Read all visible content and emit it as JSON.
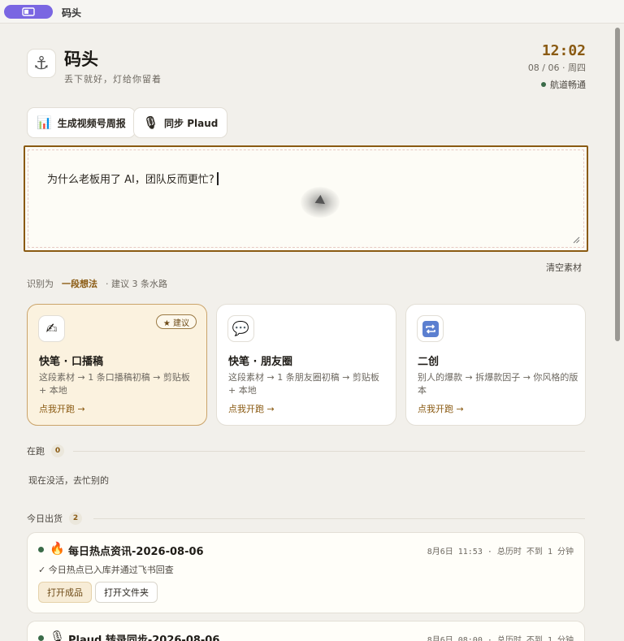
{
  "window": {
    "title": "码头"
  },
  "header": {
    "logo_icon": "anchor-icon",
    "title": "码头",
    "subtitle": "丢下就好，灯给你留着",
    "clock": "12:02",
    "date": "08 / 06 · 周四",
    "status": "航道畅通",
    "status_color": "#3a6b48"
  },
  "actions": [
    {
      "icon": "bar-chart-icon",
      "label": "生成视频号周报"
    },
    {
      "icon": "microphone-icon",
      "label": "同步 Plaud"
    }
  ],
  "editor": {
    "value": "为什么老板用了 AI，团队反而更忙?"
  },
  "clear_label": "清空素材",
  "detection": {
    "prefix": "识别为",
    "type": "一段想法",
    "suggestion": "· 建议 3 条水路"
  },
  "cards": [
    {
      "icon": "writing-hand-icon",
      "title": "快笔 · 口播稿",
      "desc": "这段素材 → 1 条口播稿初稿 → 剪贴板 + 本地",
      "link": "点我开跑 →",
      "badge": "★ 建议"
    },
    {
      "icon": "speech-bubble-icon",
      "title": "快笔 · 朋友圈",
      "desc": "这段素材 → 1 条朋友圈初稿 → 剪贴板 + 本地",
      "link": "点我开跑 →"
    },
    {
      "icon": "repeat-icon",
      "title": "二创",
      "desc": "别人的爆款 → 拆爆款因子 → 你风格的版本",
      "link": "点我开跑 →"
    }
  ],
  "running": {
    "label": "在跑",
    "count": "0",
    "empty": "现在没活，去忙别的"
  },
  "shipped": {
    "label": "今日出货",
    "count": "2",
    "tasks": [
      {
        "icon": "fire-icon",
        "title": "每日热点资讯-2026-08-06",
        "meta": "8月6日 11:53 · 总历时 不到 1 分钟",
        "check": "✓  今日热点已入库并通过飞书回查",
        "btn_primary": "打开成品",
        "btn_secondary": "打开文件夹"
      },
      {
        "icon": "microphone-icon",
        "title": "Plaud 转录同步-2026-08-06",
        "meta": "8月6日 08:00 · 总历时 不到 1 分钟"
      }
    ]
  },
  "colors": {
    "accent": "#8a5a12",
    "titlebar_pill": "#7a66e2",
    "background": "#f2f0eb"
  }
}
